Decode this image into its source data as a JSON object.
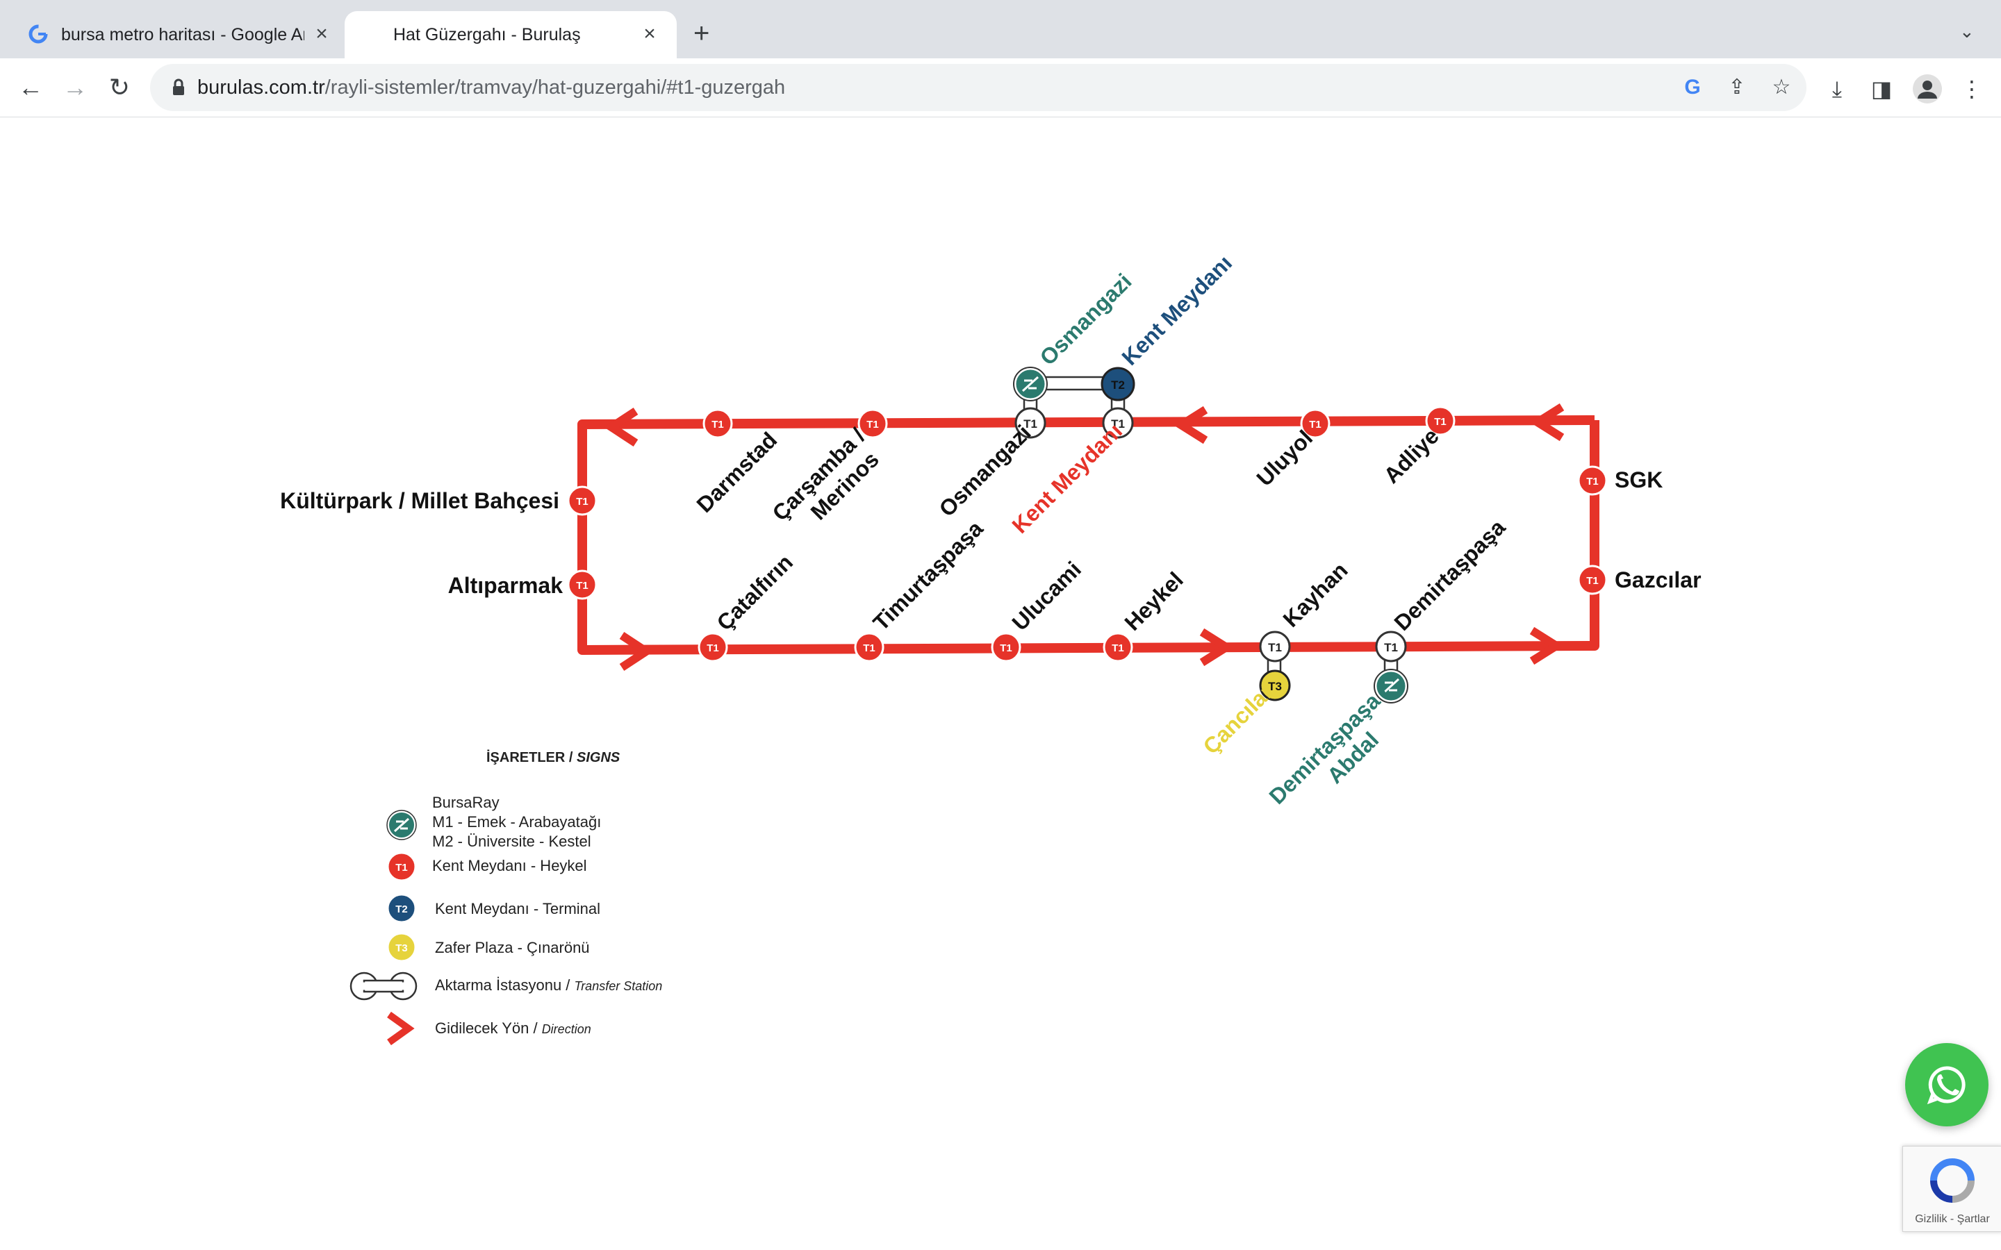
{
  "browser": {
    "tabs": [
      {
        "title": "bursa metro haritası - Google Arama",
        "active": false
      },
      {
        "title": "Hat Güzergahı - Burulaş",
        "active": true
      }
    ],
    "new_tab_symbol": "+",
    "url_host": "burulas.com.tr",
    "url_path": "/rayli-sistemler/tramvay/hat-guzergahi/#t1-guzergah"
  },
  "map": {
    "line_color": "#e63329",
    "top_stations": [
      "Darmstad",
      "Çarşamba / Merinos",
      "Osmangazi",
      "Kent Meydanı",
      "Uluyol",
      "Adliye"
    ],
    "left_stations": [
      "Kültürpark / Millet Bahçesi",
      "Altıparmak"
    ],
    "right_stations": [
      "SGK",
      "Gazcılar"
    ],
    "bottom_stations": [
      "Çatalfırın",
      "Timurtaşpaşa",
      "Ulucami",
      "Heykel",
      "Kayhan",
      "Demirtaşpaşa"
    ],
    "transfer_labels": {
      "osmangazi_m": "Osmangazi",
      "kentmeydani_t2": "Kent Meydanı",
      "cancilar_t3": "Çancılar",
      "demirtaspasa_abdal": "Demirtaşpaşa / Abdal"
    },
    "badges": {
      "t1": "T1",
      "t2": "T2",
      "t3": "T3"
    }
  },
  "legend": {
    "title": "İŞARETLER",
    "title_en": "SIGNS",
    "items": [
      {
        "lines": [
          "BursaRay",
          "M1 - Emek - Arabayatağı",
          "M2 - Üniversite - Kestel"
        ],
        "color": "#2b7a6e"
      },
      {
        "lines": [
          "Kent Meydanı - Heykel"
        ],
        "color": "#e63329"
      },
      {
        "lines": [
          "Kent Meydanı - Terminal"
        ],
        "color": "#1d4f7c"
      },
      {
        "lines": [
          "Zafer Plaza - Çınarönü"
        ],
        "color": "#e6d33c"
      }
    ],
    "transfer_label": "Aktarma İstasyonu",
    "transfer_label_en": "Transfer Station",
    "direction_label": "Gidilecek Yön",
    "direction_label_en": "Direction"
  },
  "recaptcha": {
    "text": "Gizlilik - Şartlar"
  },
  "icons": {
    "back": "arrow-left-icon",
    "forward": "arrow-right-icon",
    "reload": "reload-icon",
    "lock": "lock-icon",
    "google": "google-icon",
    "share": "share-icon",
    "bookmark": "star-icon",
    "download": "download-icon",
    "sidepanel": "side-panel-icon",
    "profile": "profile-icon",
    "menu": "kebab-menu-icon",
    "whatsapp": "whatsapp-icon"
  }
}
